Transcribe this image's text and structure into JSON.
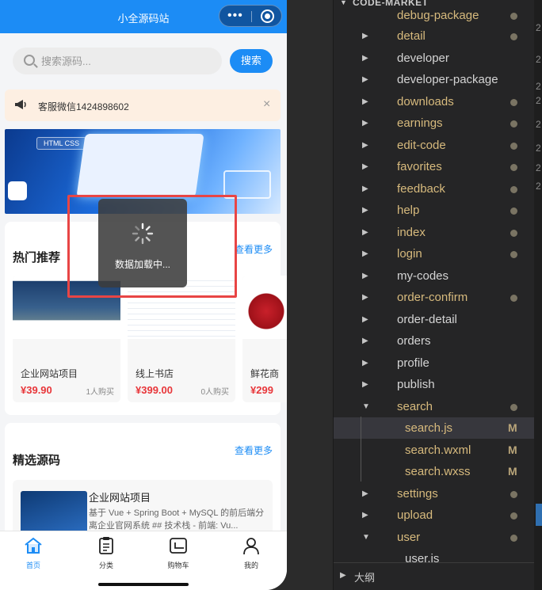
{
  "phone": {
    "app_title": "小全源码站",
    "capsule": {
      "menu_icon": "more-dots-icon",
      "close_icon": "target-icon"
    },
    "search": {
      "placeholder": "搜索源码...",
      "button_label": "搜索"
    },
    "notice": {
      "text": "客服微信1424898602",
      "icon": "megaphone-icon",
      "close": "×"
    },
    "banner": {
      "tag": "HTML CSS"
    },
    "hot": {
      "title": "热门推荐",
      "more": "查看更多",
      "items": [
        {
          "name": "企业网站项目",
          "price": "¥39.90",
          "buyers": "1人购买"
        },
        {
          "name": "线上书店",
          "price": "¥399.00",
          "buyers": "0人购买"
        },
        {
          "name": "鲜花商",
          "price": "¥299",
          "buyers": ""
        }
      ]
    },
    "selected": {
      "title": "精选源码",
      "more": "查看更多",
      "item": {
        "name": "企业网站项目",
        "desc": "基于 Vue + Spring Boot + MySQL 的前后端分离企业官网系统 ## 技术栈 - 前端: Vu..."
      }
    },
    "loading_text": "数据加载中...",
    "tabs": [
      {
        "label": "首页",
        "icon": "home-icon",
        "active": true
      },
      {
        "label": "分类",
        "icon": "list-icon",
        "active": false
      },
      {
        "label": "购物车",
        "icon": "wallet-icon",
        "active": false
      },
      {
        "label": "我的",
        "icon": "user-icon",
        "active": false
      }
    ]
  },
  "explorer": {
    "header": "CODE-MARKET",
    "items": [
      {
        "name": "debug-package",
        "modified": true
      },
      {
        "name": "detail",
        "modified": true
      },
      {
        "name": "developer",
        "modified": false
      },
      {
        "name": "developer-package",
        "modified": false
      },
      {
        "name": "downloads",
        "modified": true
      },
      {
        "name": "earnings",
        "modified": true
      },
      {
        "name": "edit-code",
        "modified": true
      },
      {
        "name": "favorites",
        "modified": true
      },
      {
        "name": "feedback",
        "modified": true
      },
      {
        "name": "help",
        "modified": true
      },
      {
        "name": "index",
        "modified": true
      },
      {
        "name": "login",
        "modified": true
      },
      {
        "name": "my-codes",
        "modified": false
      },
      {
        "name": "order-confirm",
        "modified": true
      },
      {
        "name": "order-detail",
        "modified": false
      },
      {
        "name": "orders",
        "modified": false
      },
      {
        "name": "profile",
        "modified": false
      },
      {
        "name": "publish",
        "modified": false
      },
      {
        "name": "search",
        "modified": true
      },
      {
        "name": "search.js",
        "modified": true,
        "badge": "M"
      },
      {
        "name": "search.wxml",
        "modified": true,
        "badge": "M"
      },
      {
        "name": "search.wxss",
        "modified": true,
        "badge": "M"
      },
      {
        "name": "settings",
        "modified": true
      },
      {
        "name": "upload",
        "modified": true
      },
      {
        "name": "user",
        "modified": true
      },
      {
        "name": "user.js",
        "modified": false
      }
    ],
    "footer": "大纲"
  },
  "editor_strip": {
    "digits": [
      "2",
      "2",
      "2",
      "2",
      "2",
      "2",
      "2",
      "2"
    ]
  }
}
